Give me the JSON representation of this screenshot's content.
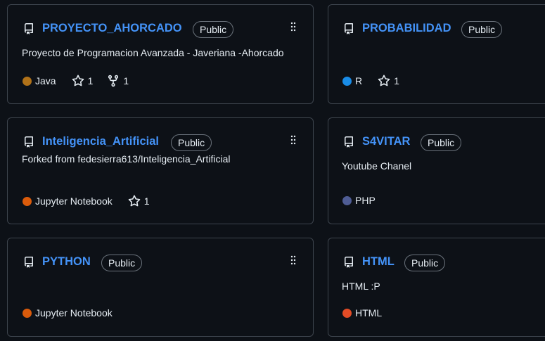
{
  "colors": {
    "background": "#0d1117",
    "border": "#3d444d",
    "link": "#4493f8",
    "text": "#e6edf3",
    "icon": "#e6edf3"
  },
  "cards": [
    {
      "name": "PROYECTO_AHORCADO",
      "visibility": "Public",
      "description": "Proyecto de Programacion Avanzada - Javeriana -Ahorcado",
      "language": "Java",
      "language_color": "#b07219",
      "stars": "1",
      "forks": "1",
      "icon": "repo-icon"
    },
    {
      "name": "PROBABILIDAD",
      "visibility": "Public",
      "description": "",
      "language": "R",
      "language_color": "#198ce7",
      "stars": "1",
      "icon": "repo-icon"
    },
    {
      "name": "Inteligencia_Artificial",
      "visibility": "Public",
      "description": "Forked from fedesierra613/Inteligencia_Artificial",
      "language": "Jupyter Notebook",
      "language_color": "#da5b0b",
      "stars": "1",
      "icon": "repo-icon"
    },
    {
      "name": "S4VITAR",
      "visibility": "Public",
      "description": "Youtube Chanel",
      "language": "PHP",
      "language_color": "#4f5d95",
      "icon": "repo-icon"
    },
    {
      "name": "PYTHON",
      "visibility": "Public",
      "description": "",
      "language": "Jupyter Notebook",
      "language_color": "#da5b0b",
      "icon": "repo-icon"
    },
    {
      "name": "HTML",
      "visibility": "Public",
      "description": "HTML :P",
      "language": "HTML",
      "language_color": "#e34c26",
      "icon": "repo-icon"
    }
  ]
}
